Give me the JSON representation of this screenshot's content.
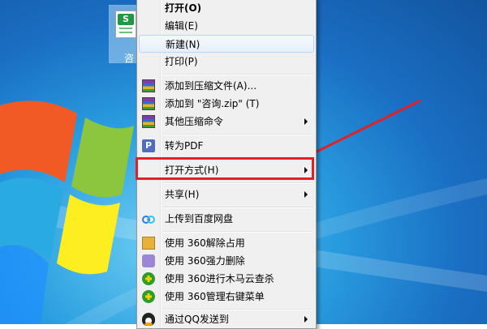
{
  "desktop": {
    "file_icon_label": "咨"
  },
  "context_menu": {
    "items": [
      {
        "label": "打开(O)",
        "bold": true
      },
      {
        "label": "编辑(E)"
      },
      {
        "label": "新建(N)"
      },
      {
        "label": "打印(P)"
      },
      {
        "label": "添加到压缩文件(A)..."
      },
      {
        "label": "添加到 \"咨询.zip\" (T)"
      },
      {
        "label": "其他压缩命令"
      },
      {
        "label": "转为PDF"
      },
      {
        "label": "打开方式(H)"
      },
      {
        "label": "共享(H)"
      },
      {
        "label": "上传到百度网盘"
      },
      {
        "label": "使用 360解除占用"
      },
      {
        "label": "使用 360强力删除"
      },
      {
        "label": "使用 360进行木马云查杀"
      },
      {
        "label": "使用 360管理右键菜单"
      },
      {
        "label": "通过QQ发送到"
      }
    ]
  },
  "icons": {
    "zip": "winrar-archive-icon",
    "pdf": "pdf-convert-icon",
    "pdf_glyph": "P",
    "baidu": "baidu-netdisk-icon",
    "unlock": "360-unlock-icon",
    "shred": "360-shred-icon",
    "scan": "360-scan-icon",
    "manage": "360-manage-icon",
    "qq": "qq-penguin-icon"
  },
  "colors": {
    "highlight_border": "#e02127",
    "annotation_arrow": "#e02127",
    "menu_background": "#f0f0f0",
    "hover_border": "#b8d6fb"
  }
}
